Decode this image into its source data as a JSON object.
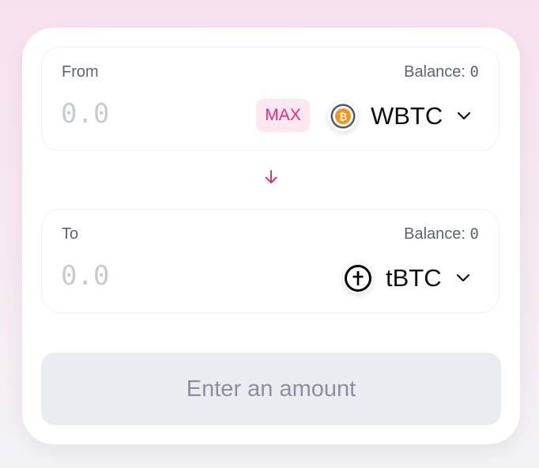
{
  "from": {
    "label": "From",
    "balance_label": "Balance:",
    "balance_value": "0",
    "amount_placeholder": "0.0",
    "max_label": "MAX",
    "token": {
      "symbol": "WBTC",
      "icon": "wbtc-icon"
    }
  },
  "to": {
    "label": "To",
    "balance_label": "Balance:",
    "balance_value": "0",
    "amount_placeholder": "0.0",
    "token": {
      "symbol": "tBTC",
      "icon": "tbtc-icon"
    }
  },
  "swap_icon": "arrow-down-icon",
  "submit": {
    "label": "Enter an amount",
    "disabled": true
  },
  "colors": {
    "accent": "#EA2C7B",
    "max_bg": "#FDE7F0",
    "btc_orange": "#F7931A",
    "button_bg": "#EBECF0",
    "button_text": "#8B909F"
  }
}
